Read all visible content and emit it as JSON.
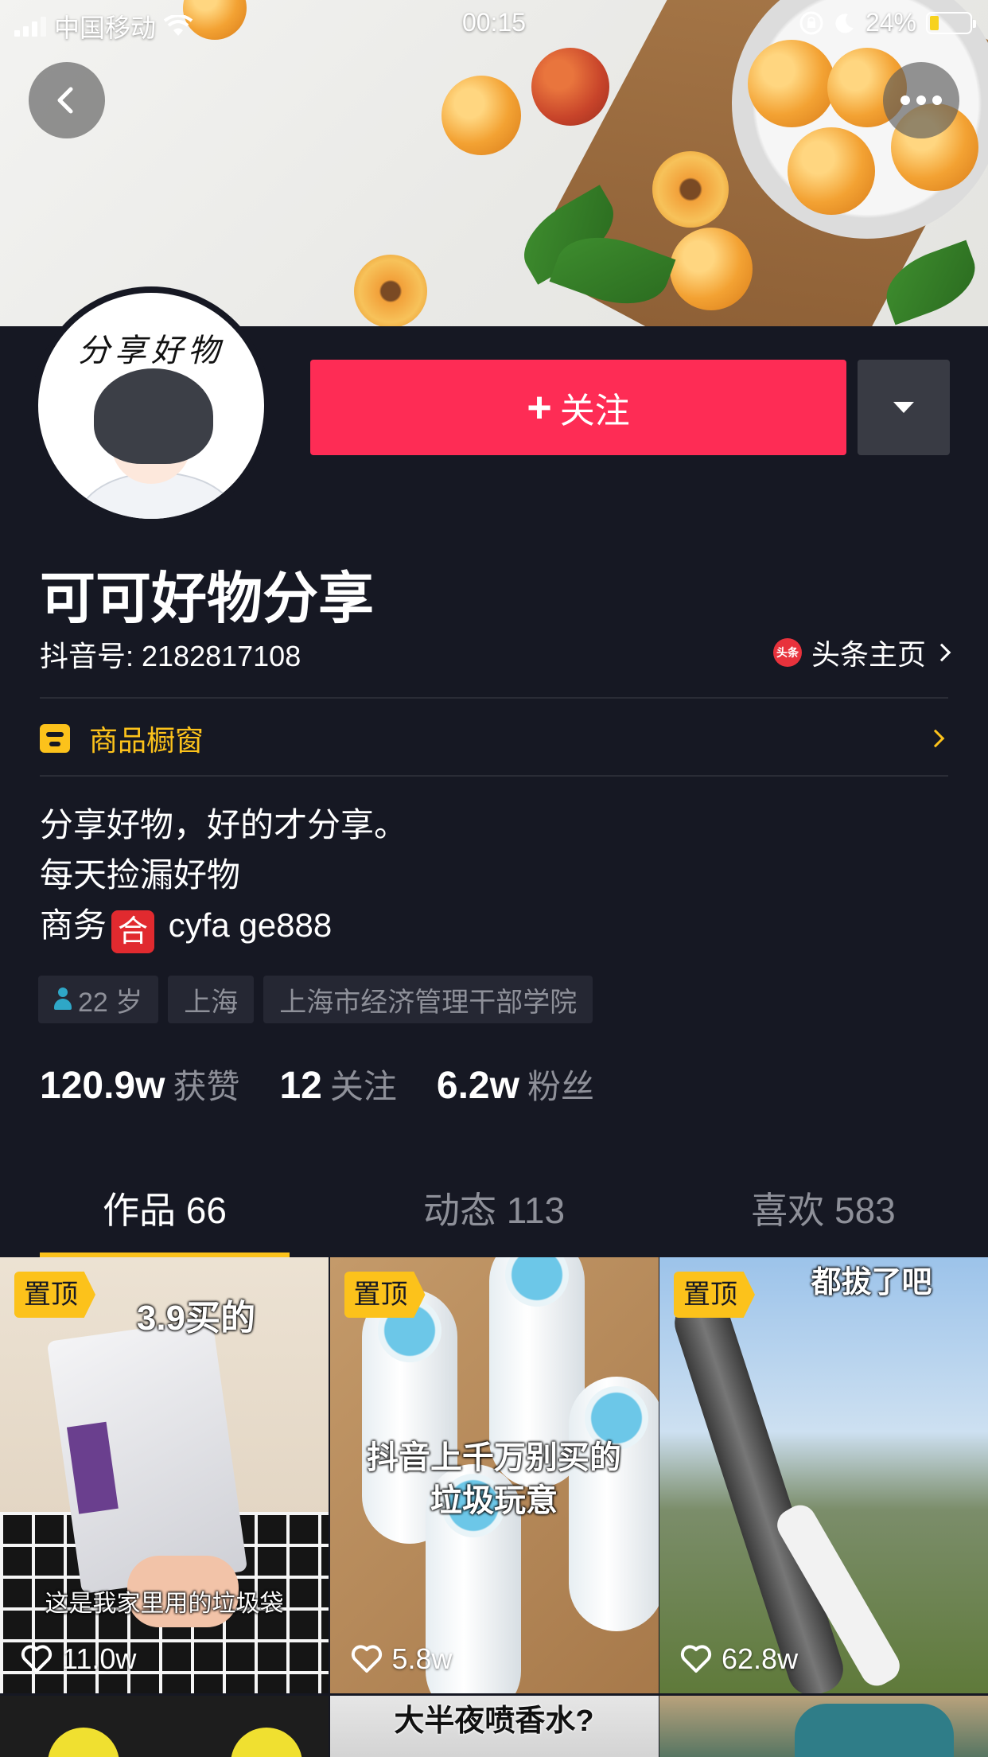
{
  "status_bar": {
    "carrier": "中国移动",
    "time": "00:15",
    "battery": "24%",
    "battery_level": 0.24
  },
  "profile": {
    "avatar_text": "分享好物",
    "follow_label": "关注",
    "name": "可可好物分享",
    "douyin_id": "抖音号: 2182817108",
    "toutiao_label": "头条主页",
    "toutiao_badge": "头条",
    "shop_label": "商品橱窗",
    "bio": {
      "line1": "分享好物，好的才分享。",
      "line2": "每天捡漏好物",
      "line3_prefix": "商务",
      "line3_badge": "合",
      "line3_suffix": " cyfa ge888"
    },
    "tags": [
      "22 岁",
      "上海",
      "上海市经济管理干部学院"
    ],
    "stats": [
      {
        "num": "120.9w",
        "label": "获赞"
      },
      {
        "num": "12",
        "label": "关注"
      },
      {
        "num": "6.2w",
        "label": "粉丝"
      }
    ]
  },
  "tabs": [
    {
      "label": "作品 66",
      "active": true
    },
    {
      "label": "动态 113",
      "active": false
    },
    {
      "label": "喜欢 583",
      "active": false
    }
  ],
  "videos": [
    {
      "pin": "置顶",
      "caption_top": "3.9买的",
      "caption_bottom": "这是我家里用的垃圾袋",
      "likes": "11.0w"
    },
    {
      "pin": "置顶",
      "caption_mid": "抖音上千万别买的\n垃圾玩意",
      "likes": "5.8w"
    },
    {
      "pin": "置顶",
      "caption_top": "都拔了吧",
      "likes": "62.8w"
    },
    {
      "caption_top": ""
    },
    {
      "caption_top": "大半夜喷香水?"
    },
    {
      "caption_top": ""
    }
  ],
  "colors": {
    "background": "#161823",
    "accent_red": "#fe2c55",
    "accent_yellow": "#fcc21b",
    "muted_text": "#8e9099"
  }
}
